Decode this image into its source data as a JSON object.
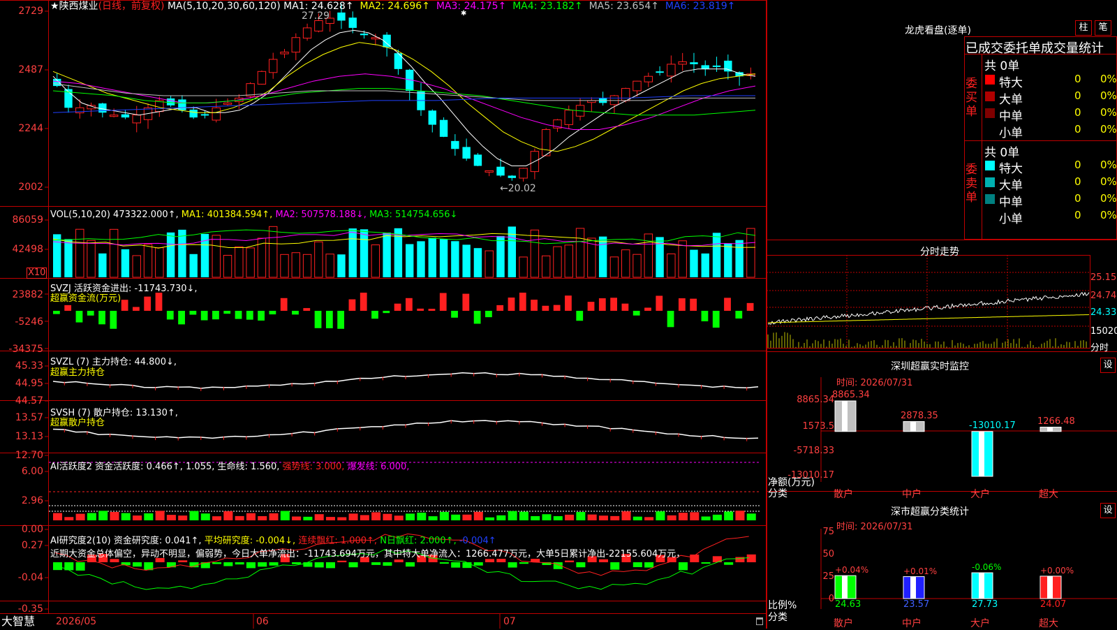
{
  "stock": {
    "star": "★",
    "name": "陕西煤业",
    "period": "(日线，前复权)"
  },
  "price_panel": {
    "ma_header": "MA(5,10,20,30,60,120)",
    "ma_values": [
      {
        "label": "MA1: 24.628↑",
        "color": "#ffffff"
      },
      {
        "label": "MA2: 24.696↑",
        "color": "#ffff00"
      },
      {
        "label": "MA3: 24.175↑",
        "color": "#ff00ff"
      },
      {
        "label": "MA4: 23.182↑",
        "color": "#00ff00"
      },
      {
        "label": "MA5: 23.654↑",
        "color": "#c0c0c0"
      },
      {
        "label": "MA6: 23.819↑",
        "color": "#0000ff"
      }
    ],
    "y_ticks": [
      "2729",
      "2487",
      "2244",
      "2002"
    ],
    "high_label": "27.29",
    "low_label": "←20.02",
    "marker": "✱"
  },
  "vol_panel": {
    "header": "VOL(5,10,20)",
    "value": "473322.000↑,",
    "ma1": "MA1: 401384.594↑,",
    "ma2": "MA2: 507578.188↓,",
    "ma3": "MA3: 514754.656↓",
    "y_ticks": [
      "86059",
      "42498"
    ],
    "unit": "X10"
  },
  "svzj_panel": {
    "header": "SVZJ  活跃资金进出: -11743.730↓,",
    "subtitle": "超赢资金流(万元)",
    "y_ticks": [
      "23882",
      "-5246",
      "-34375"
    ]
  },
  "svzl_panel": {
    "header": "SVZL (7) 主力持仓: 44.800↓,",
    "subtitle": "超赢主力持仓",
    "y_ticks": [
      "45.33",
      "44.95",
      "44.57"
    ]
  },
  "svsh_panel": {
    "header": "SVSH (7) 散户持仓: 13.130↑,",
    "subtitle": "超赢散户持仓",
    "y_ticks": [
      "13.57",
      "13.13",
      "12.70"
    ]
  },
  "ai_active_panel": {
    "header": "AI活跃度2 资金活跃度: 0.466↑,",
    "v2": "1.055,",
    "life": "生命线: 1.560,",
    "strong": "强势线: 3.000,",
    "burst": "爆发线: 6.000,",
    "y_ticks": [
      "6.00",
      "2.96",
      "0.00"
    ]
  },
  "ai_research_panel": {
    "header": "AI研究度2(10) 资金研究度: 0.041↑,",
    "avg": "平均研究度: -0.004↓,",
    "cont": "连续飘红: 1.000↑,",
    "nday": "N日飘红: 2.000↑,",
    "last": "-0.004↑",
    "commentary": "近期大资金总体偏空，异动不明显，偏弱势，今日大单净流出：-11743.694万元，其中特大单净流入：1266.477万元，大单5日累计净出-22155.604万元，",
    "y_ticks": [
      "0.27",
      "-0.04",
      "-0.35"
    ]
  },
  "bottom_bar": {
    "brand": "大智慧",
    "dates": [
      "2026/05",
      "06",
      "07"
    ]
  },
  "dragon_tiger": {
    "title": "龙虎看盘(逐单)",
    "btn1": "柱",
    "btn2": "笔",
    "subtitle": "已成交委托单成交量统计",
    "buy_label": "委买单",
    "sell_label": "委卖单",
    "buy_total": "共 0单",
    "sell_total": "共 0单",
    "buy_rows": [
      {
        "name": "特大",
        "val": "0",
        "pct": "0%",
        "color": "#ff0000"
      },
      {
        "name": "大单",
        "val": "0",
        "pct": "0%",
        "color": "#b00000"
      },
      {
        "name": "中单",
        "val": "0",
        "pct": "0%",
        "color": "#800000"
      },
      {
        "name": "小单",
        "val": "0",
        "pct": "0%",
        "color": "#000000"
      }
    ],
    "sell_rows": [
      {
        "name": "特大",
        "val": "0",
        "pct": "0%",
        "color": "#00ffff"
      },
      {
        "name": "大单",
        "val": "0",
        "pct": "0%",
        "color": "#00b0b0"
      },
      {
        "name": "中单",
        "val": "0",
        "pct": "0%",
        "color": "#008080"
      },
      {
        "name": "小单",
        "val": "0",
        "pct": "0%",
        "color": "#000000"
      }
    ]
  },
  "intraday": {
    "title": "分时走势",
    "ticks": [
      "25.15",
      "24.74",
      "24.33"
    ],
    "vol": "15020",
    "sub": "分时"
  },
  "sz_monitor": {
    "title": "深圳超赢实时监控",
    "btn": "设",
    "time": "时间: 2026/07/31",
    "y_ticks": [
      "8865.34",
      "1573.5",
      "-5718.33",
      "-13010.17"
    ],
    "ylabel": "净额(万元)",
    "xlabel": "分类",
    "bars": [
      {
        "name": "散户",
        "value": "8865.34"
      },
      {
        "name": "中户",
        "value": "2878.35"
      },
      {
        "name": "大户",
        "value": "-13010.17"
      },
      {
        "name": "超大",
        "value": "1266.48"
      }
    ]
  },
  "sz_classify": {
    "title": "深市超赢分类统计",
    "btn": "设",
    "time": "时间: 2026/07/31",
    "y_ticks": [
      "75",
      "50",
      "25",
      "0"
    ],
    "ylabel": "比例%",
    "xlabel": "分类",
    "bars": [
      {
        "name": "散户",
        "change": "+0.04%",
        "value": "24.63"
      },
      {
        "name": "中户",
        "change": "+0.01%",
        "value": "23.57"
      },
      {
        "name": "大户",
        "change": "-0.06%",
        "value": "27.73"
      },
      {
        "name": "超大",
        "change": "+0.00%",
        "value": "24.07"
      }
    ]
  },
  "chart_data": [
    {
      "type": "candlestick",
      "title": "陕西煤业 (日线，前复权)",
      "x": [
        "2026/05",
        "06",
        "07"
      ],
      "ylim": [
        20.02,
        27.29
      ],
      "close": [
        24.2,
        23.3,
        23.3,
        23.4,
        23.1,
        23.0,
        22.9,
        23.0,
        23.3,
        23.6,
        23.4,
        23.2,
        22.9,
        23.0,
        23.3,
        23.5,
        23.7,
        24.3,
        24.8,
        25.3,
        25.6,
        26.2,
        26.6,
        26.9,
        27.0,
        26.9,
        26.6,
        26.3,
        26.2,
        25.8,
        24.9,
        24.0,
        23.2,
        22.6,
        22.1,
        21.6,
        21.2,
        20.9,
        20.7,
        20.5,
        20.4,
        20.8,
        21.5,
        22.4,
        22.8,
        23.2,
        23.4,
        23.6,
        23.5,
        23.8,
        24.1,
        24.4,
        24.6,
        24.8,
        25.1,
        25.2,
        25.1,
        24.9,
        25.0,
        24.8,
        24.6,
        24.7
      ],
      "ma1": [
        24.6,
        24.0,
        23.5,
        23.3,
        23.2,
        23.1,
        23.0,
        23.1,
        23.2,
        23.3,
        23.3,
        23.1,
        23.1,
        23.2,
        23.5,
        23.9,
        24.5,
        25.1,
        25.7,
        26.1,
        26.4,
        26.5,
        26.4,
        26.1,
        25.6,
        25.0,
        24.3,
        23.7,
        23.0,
        22.3,
        21.7,
        21.2,
        20.9,
        20.9,
        21.2,
        21.6,
        22.1,
        22.5,
        22.9,
        23.3,
        23.6,
        23.9,
        24.2,
        24.5,
        24.8,
        24.9,
        24.9,
        24.9,
        24.7,
        24.6
      ],
      "ma2": [
        24.8,
        24.5,
        24.2,
        23.9,
        23.7,
        23.5,
        23.3,
        23.2,
        23.1,
        23.1,
        23.3,
        23.6,
        24.0,
        24.6,
        25.1,
        25.5,
        25.8,
        26.0,
        25.9,
        25.7,
        25.3,
        24.8,
        24.2,
        23.5,
        22.9,
        22.3,
        21.9,
        21.6,
        21.5,
        21.7,
        22.0,
        22.4,
        22.8,
        23.2,
        23.6,
        24.0,
        24.3,
        24.5,
        24.6,
        24.7
      ],
      "ma3": [
        24.4,
        24.3,
        24.1,
        23.9,
        23.7,
        23.5,
        23.5,
        23.6,
        23.8,
        24.1,
        24.4,
        24.6,
        24.7,
        24.6,
        24.4,
        24.1,
        23.7,
        23.3,
        22.9,
        22.6,
        22.4,
        22.4,
        22.6,
        22.9,
        23.3,
        23.7,
        24.0,
        24.2
      ],
      "ma4": [
        24.0,
        23.9,
        23.8,
        23.6,
        23.5,
        23.5,
        23.6,
        23.7,
        23.9,
        24.0,
        24.1,
        24.1,
        24.0,
        23.9,
        23.8,
        23.6,
        23.4,
        23.2,
        23.1,
        23.0,
        23.0,
        23.0,
        23.1,
        23.2
      ],
      "ma5": [
        24.3,
        24.1,
        23.9,
        23.8,
        23.8,
        23.8,
        23.9,
        24.0,
        24.0,
        24.0,
        23.9,
        23.8,
        23.7,
        23.6,
        23.6,
        23.6,
        23.6,
        23.7,
        23.7,
        23.7
      ],
      "ma6": [
        23.1,
        23.2,
        23.3,
        23.4,
        23.5,
        23.6,
        23.6,
        23.7,
        23.7,
        23.7,
        23.8,
        23.8
      ]
    }
  ]
}
